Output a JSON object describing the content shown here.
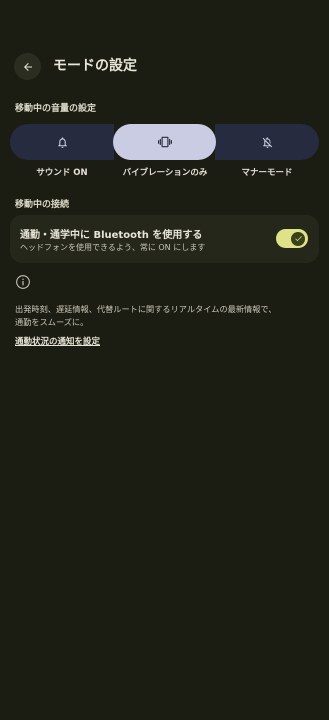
{
  "header": {
    "title": "モードの設定",
    "back_icon": "arrow-left-icon"
  },
  "volume_section": {
    "label": "移動中の音量の設定",
    "options": [
      {
        "label": "サウンド ON",
        "icon": "bell-icon",
        "selected": false
      },
      {
        "label": "バイブレーションのみ",
        "icon": "vibrate-icon",
        "selected": true
      },
      {
        "label": "マナーモード",
        "icon": "bell-off-icon",
        "selected": false
      }
    ]
  },
  "connection_section": {
    "label": "移動中の接続",
    "bluetooth_title": "通勤・通学中に Bluetooth を使用する",
    "bluetooth_subtitle": "ヘッドフォンを使用できるよう、常に ON にします",
    "toggle_on": true
  },
  "info": {
    "icon": "info-icon",
    "description_line1": "出発時刻、遅延情報、代替ルートに関するリアルタイムの最新情報で、",
    "description_line2": "通勤をスムーズに。",
    "link_label": "通勤状況の通知を設定"
  },
  "colors": {
    "background": "#1b1c12",
    "segment_unselected": "#262b40",
    "segment_selected": "#c9cce3",
    "toggle_track": "#dfe388",
    "card": "#25271b"
  }
}
